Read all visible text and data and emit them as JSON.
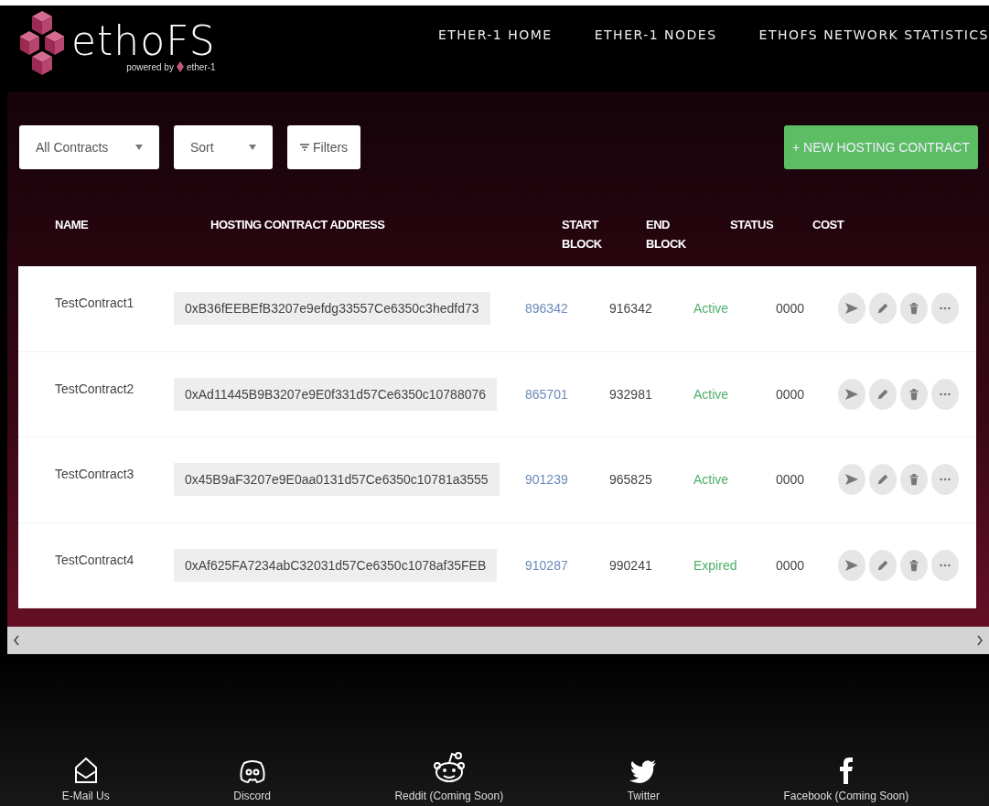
{
  "header": {
    "logo": {
      "title": "ethoFS",
      "tagline_prefix": "powered by",
      "tagline_brand": "ether-1"
    },
    "nav": [
      "ETHER-1 HOME",
      "ETHER-1 NODES",
      "ETHOFS NETWORK STATISTICS"
    ]
  },
  "toolbar": {
    "contract_filter": "All Contracts",
    "sort": "Sort",
    "filters": "Filters",
    "new_button": "+ NEW HOSTING CONTRACT"
  },
  "table": {
    "columns": [
      "NAME",
      "HOSTING CONTRACT ADDRESS",
      "START BLOCK",
      "END BLOCK",
      "STATUS",
      "COST"
    ],
    "rows": [
      {
        "name": "TestContract1",
        "address": "0xB36fEEBEfB3207e9efdg33557Ce6350c3hedfd73",
        "start_block": "896342",
        "end_block": "916342",
        "status": "Active",
        "cost": "0000"
      },
      {
        "name": "TestContract2",
        "address": "0xAd11445B9B3207e9E0f331d57Ce6350c10788076",
        "start_block": "865701",
        "end_block": "932981",
        "status": "Active",
        "cost": "0000"
      },
      {
        "name": "TestContract3",
        "address": "0x45B9aF3207e9E0aa0131d57Ce6350c10781a3555",
        "start_block": "901239",
        "end_block": "965825",
        "status": "Active",
        "cost": "0000"
      },
      {
        "name": "TestContract4",
        "address": "0xAf625FA7234abC32031d57Ce6350c1078af35FEB",
        "start_block": "910287",
        "end_block": "990241",
        "status": "Expired",
        "cost": "0000"
      }
    ]
  },
  "footer": {
    "links": [
      {
        "kind": "email",
        "label": "E-Mail Us"
      },
      {
        "kind": "discord",
        "label": "Discord"
      },
      {
        "kind": "reddit",
        "label": "Reddit (Coming Soon)"
      },
      {
        "kind": "twitter",
        "label": "Twitter"
      },
      {
        "kind": "facebook",
        "label": "Facebook (Coming Soon)"
      }
    ]
  }
}
